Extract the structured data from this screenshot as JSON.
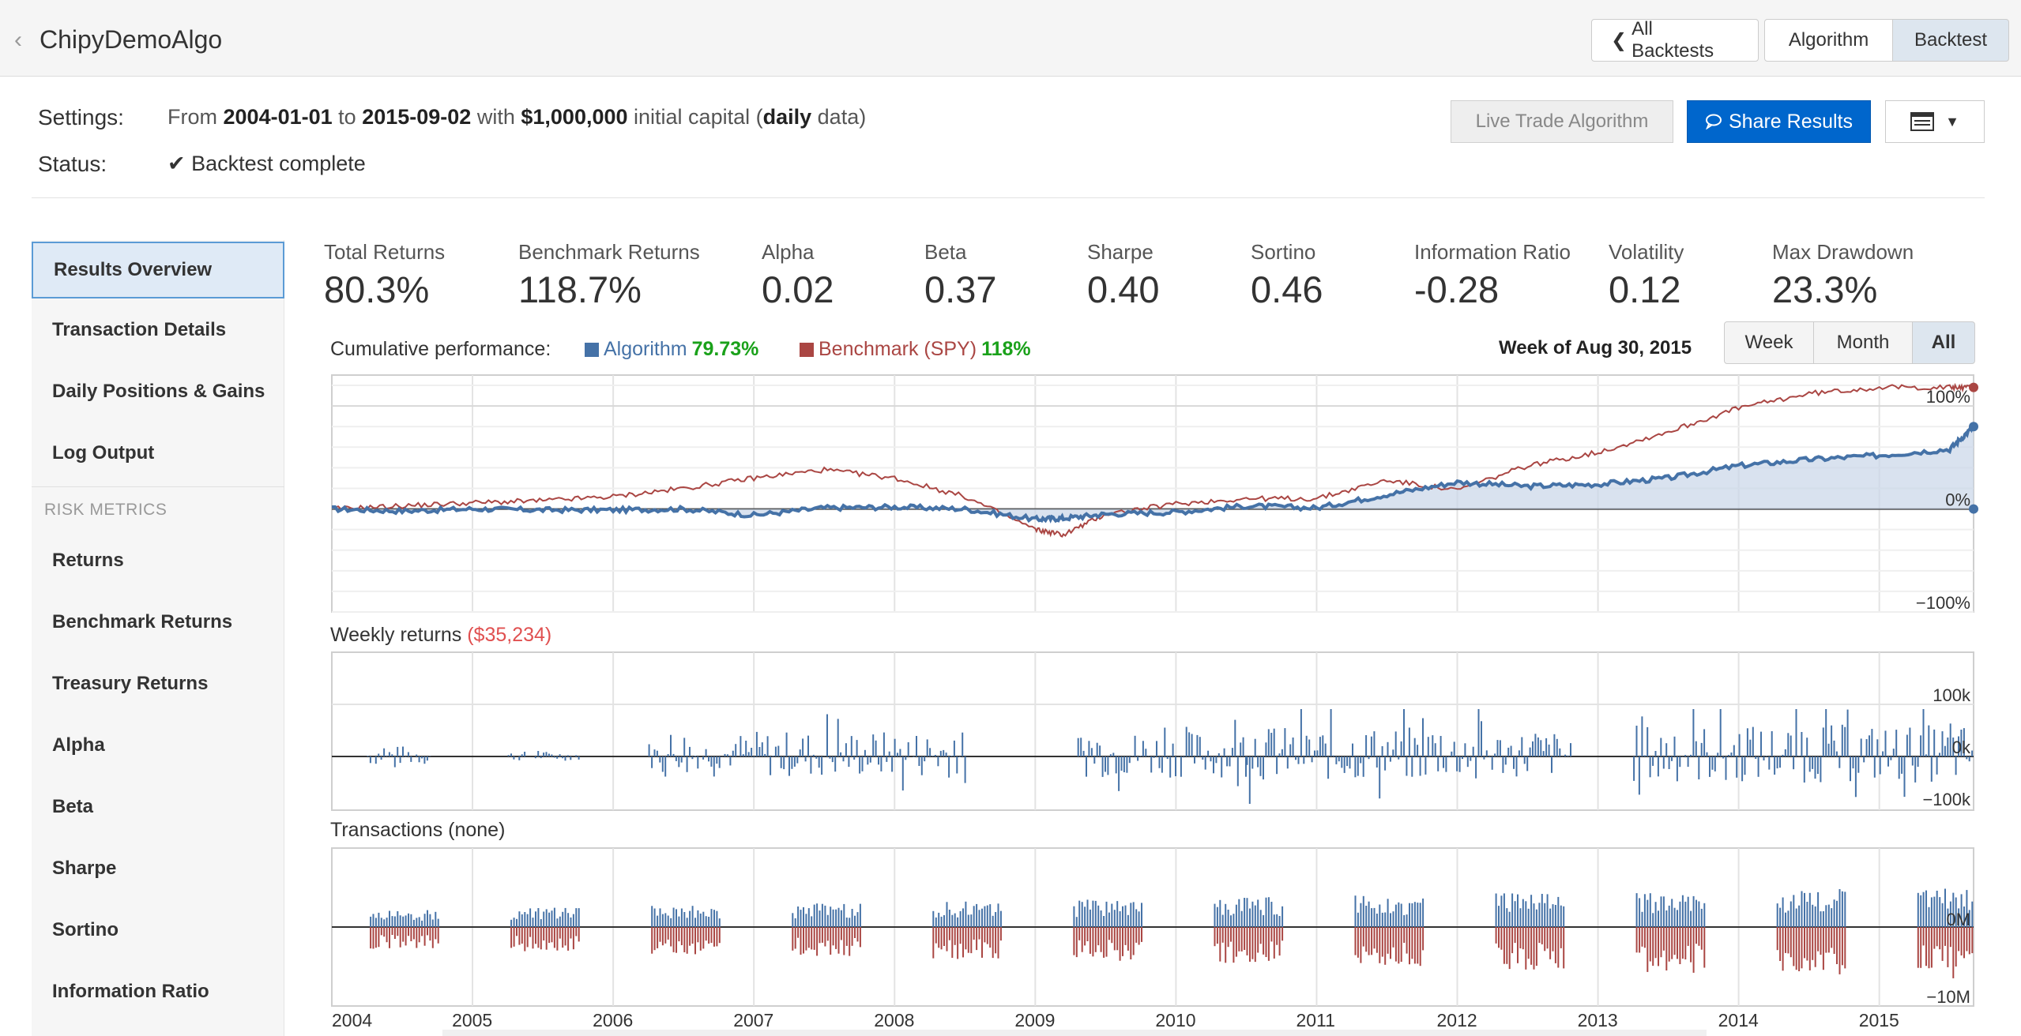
{
  "app": {
    "title": "ChipyDemoAlgo"
  },
  "nav": {
    "all_backtests": "All Backtests",
    "algorithm": "Algorithm",
    "backtest": "Backtest"
  },
  "settings": {
    "label": "Settings:",
    "from_prefix": "From",
    "start_date": "2004-01-01",
    "to_word": "to",
    "end_date": "2015-09-02",
    "with_word": "with",
    "capital": "$1,000,000",
    "capital_suffix": "initial capital (",
    "frequency": "daily",
    "frequency_suffix": "data)"
  },
  "status": {
    "label": "Status:",
    "text": "Backtest complete"
  },
  "actions": {
    "live_trade": "Live Trade Algorithm",
    "share": "Share Results"
  },
  "sidebar": {
    "items": [
      {
        "label": "Results Overview",
        "active": true
      },
      {
        "label": "Transaction Details"
      },
      {
        "label": "Daily Positions & Gains"
      },
      {
        "label": "Log Output"
      }
    ],
    "section_label": "RISK METRICS",
    "risk_items": [
      {
        "label": "Returns"
      },
      {
        "label": "Benchmark Returns"
      },
      {
        "label": "Treasury Returns"
      },
      {
        "label": "Alpha"
      },
      {
        "label": "Beta"
      },
      {
        "label": "Sharpe"
      },
      {
        "label": "Sortino"
      },
      {
        "label": "Information Ratio"
      }
    ]
  },
  "metrics": [
    {
      "label": "Total Returns",
      "value": "80.3%"
    },
    {
      "label": "Benchmark Returns",
      "value": "118.7%"
    },
    {
      "label": "Alpha",
      "value": "0.02"
    },
    {
      "label": "Beta",
      "value": "0.37"
    },
    {
      "label": "Sharpe",
      "value": "0.40"
    },
    {
      "label": "Sortino",
      "value": "0.46"
    },
    {
      "label": "Information Ratio",
      "value": "-0.28"
    },
    {
      "label": "Volatility",
      "value": "0.12"
    },
    {
      "label": "Max Drawdown",
      "value": "23.3%"
    }
  ],
  "cumulative": {
    "label": "Cumulative performance:",
    "algorithm_label": "Algorithm",
    "algorithm_pct": "79.73%",
    "benchmark_label": "Benchmark (SPY)",
    "benchmark_pct": "118%",
    "week_of": "Week of Aug 30, 2015",
    "ranges": [
      "Week",
      "Month",
      "All"
    ],
    "active_range": "All",
    "y_ticks": [
      "100%",
      "0%",
      "−100%"
    ]
  },
  "weekly_returns": {
    "label": "Weekly returns",
    "value": "($35,234)",
    "y_ticks": [
      "100k",
      "0k",
      "−100k"
    ]
  },
  "transactions": {
    "label": "Transactions (none)",
    "y_ticks": [
      "0M",
      "−10M"
    ]
  },
  "x_axis": [
    "2004",
    "2005",
    "2006",
    "2007",
    "2008",
    "2009",
    "2010",
    "2011",
    "2012",
    "2013",
    "2014",
    "2015"
  ],
  "colors": {
    "algorithm": "#4572a7",
    "benchmark": "#aa4643",
    "share_button": "#0066cc",
    "positive_pct": "#1aa11a",
    "negative_value": "#e05050"
  },
  "chart_data": [
    {
      "type": "line",
      "title": "Cumulative performance",
      "x": [
        2004.0,
        2004.5,
        2005.0,
        2005.5,
        2006.0,
        2006.5,
        2007.0,
        2007.5,
        2008.0,
        2008.5,
        2009.0,
        2009.2,
        2009.5,
        2010.0,
        2010.5,
        2011.0,
        2011.5,
        2012.0,
        2012.5,
        2013.0,
        2013.5,
        2014.0,
        2014.5,
        2015.0,
        2015.5,
        2015.67
      ],
      "series": [
        {
          "name": "Algorithm",
          "values": [
            0,
            -2,
            0,
            -1,
            -1,
            0,
            -6,
            1,
            2,
            0,
            -10,
            -9,
            -5,
            -3,
            3,
            1,
            14,
            26,
            22,
            24,
            30,
            42,
            48,
            52,
            58,
            80
          ]
        },
        {
          "name": "Benchmark (SPY)",
          "values": [
            0,
            3,
            6,
            8,
            12,
            20,
            30,
            38,
            30,
            12,
            -20,
            -25,
            -5,
            5,
            10,
            10,
            28,
            18,
            42,
            55,
            75,
            98,
            112,
            118,
            118,
            118
          ]
        }
      ],
      "ylim": [
        -100,
        130
      ]
    },
    {
      "type": "bar",
      "title": "Weekly returns",
      "note": "weekly bars of the algorithm's dollar returns, roughly between -100k and +100k",
      "ylim": [
        -100000,
        100000
      ]
    },
    {
      "type": "bar",
      "title": "Transactions",
      "note": "buy (positive) and sell (negative) transaction clusters each year",
      "ylim": [
        -10000000,
        10000000
      ]
    }
  ]
}
